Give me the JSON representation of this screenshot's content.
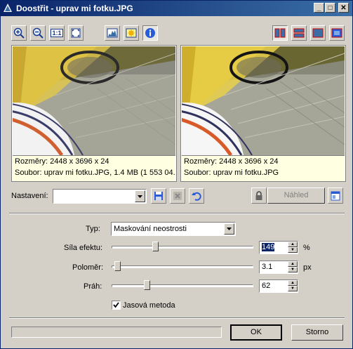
{
  "window": {
    "title": "Doostřit - uprav mi fotku.JPG",
    "controls": {
      "minimize": "_",
      "maximize": "□",
      "close": "✕"
    }
  },
  "toolbar": {
    "left_tools": [
      "zoom-in-icon",
      "zoom-out-icon",
      "actual-size-icon",
      "fit-window-icon"
    ],
    "actual_size_label": "1:1",
    "middle_tools": [
      "histogram-icon",
      "highlight-icon",
      "info-icon"
    ],
    "right_tools": [
      "split-vertical-icon",
      "split-horizontal-icon",
      "single-original-icon",
      "single-result-icon"
    ]
  },
  "previews": [
    {
      "side": "original",
      "line1": "Rozměry: 2448 x 3696 x 24",
      "line2": "Soubor: uprav mi fotku.JPG, 1.4 MB (1 553 04..."
    },
    {
      "side": "result",
      "line1": "Rozměry: 2448 x 3696 x 24",
      "line2": "Soubor: uprav mi fotku.JPG"
    }
  ],
  "settings": {
    "label": "Nastavení:",
    "value": "",
    "preview_button": "Náhled"
  },
  "params": {
    "type_label": "Typ:",
    "type_value": "Maskování neostrosti",
    "strength_label": "Síla efektu:",
    "strength_value": "149",
    "strength_unit": "%",
    "strength_level": 0.3,
    "radius_label": "Poloměr:",
    "radius_value": "3.1",
    "radius_unit": "px",
    "radius_level": 0.02,
    "threshold_label": "Práh:",
    "threshold_value": "62",
    "threshold_level": 0.24,
    "brightness_method_label": "Jasová metoda",
    "brightness_method_checked": true
  },
  "footer": {
    "progress": 0,
    "ok_label": "OK",
    "cancel_label": "Storno"
  }
}
